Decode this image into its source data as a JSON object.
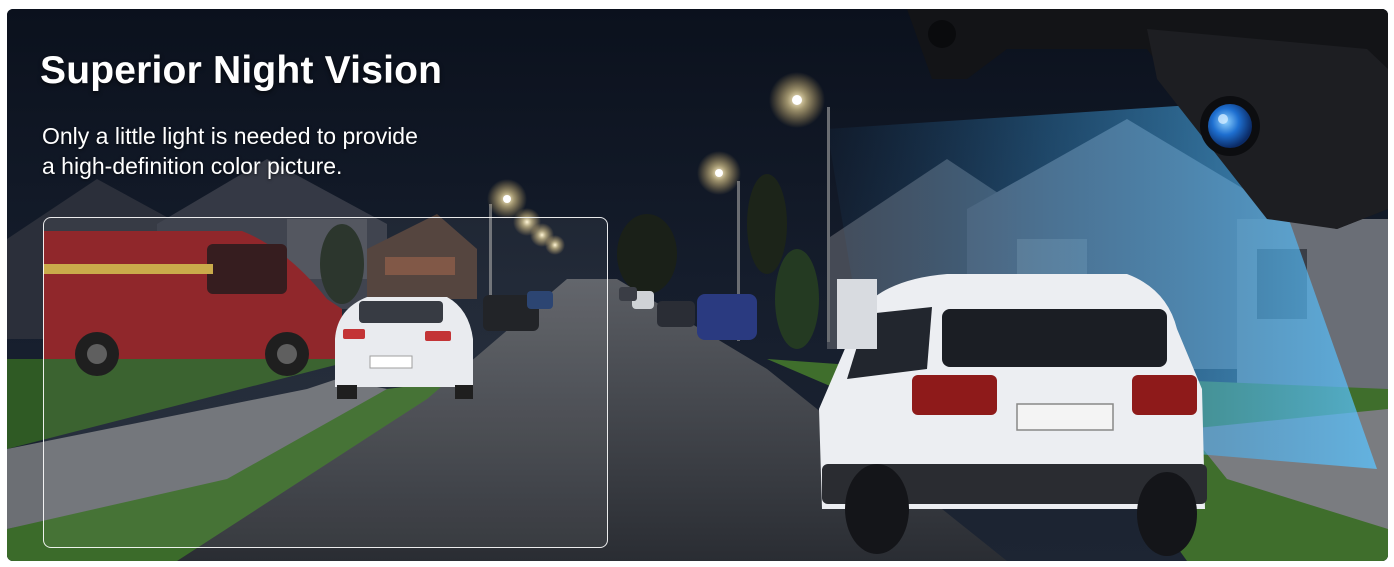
{
  "banner": {
    "title": "Superior Night Vision",
    "subtitle_lines": [
      "Only a little light is needed to provide",
      "a high-definition color picture."
    ]
  },
  "colors": {
    "sky": "#101624",
    "road": "#2c2f35",
    "grass": "#2f5a24",
    "beam": "#4fb6ff",
    "text": "#ffffff"
  },
  "scene_elements": [
    "red-van",
    "white-sedan",
    "white-suv",
    "street-lamps",
    "backup-camera",
    "camera-beam",
    "houses",
    "sidewalk",
    "road"
  ]
}
